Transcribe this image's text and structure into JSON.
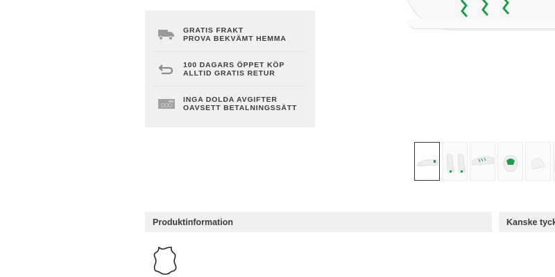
{
  "benefits": [
    {
      "icon": "truck-icon",
      "line1": "GRATIS FRAKT",
      "line2": "PROVA BEKVÄMT HEMMA"
    },
    {
      "icon": "return-arrow-icon",
      "line1": "100 DAGARS ÖPPET KÖP",
      "line2": "ALLTID GRATIS RETUR"
    },
    {
      "icon": "money-icon",
      "line1": "INGA DOLDA AVGIFTER",
      "line2": "OAVSETT BETALNINGSSÄTT"
    }
  ],
  "thumbnails": {
    "selected_index": 0
  },
  "sections": {
    "product_info": "Produktinformation",
    "maybe_like": "Kanske tycker du om"
  },
  "material_icon": "leather-icon",
  "colors": {
    "panel_bg": "#f0f0f0",
    "accent_green": "#1e9a4a"
  }
}
